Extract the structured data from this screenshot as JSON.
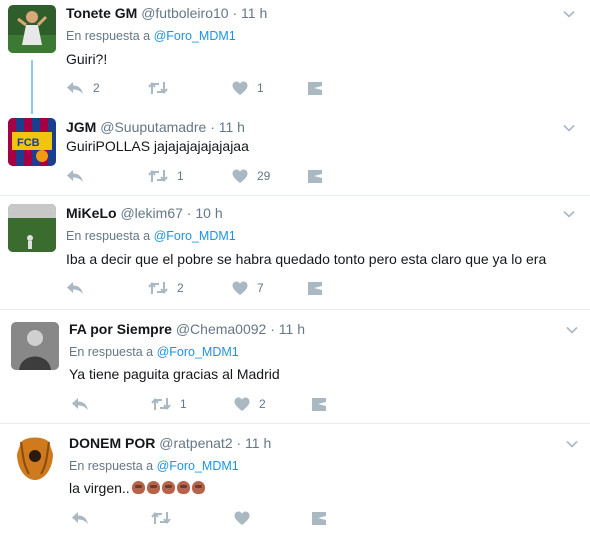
{
  "tweets": [
    {
      "name": "Tonete GM",
      "handle": "@futboleiro10",
      "sep": "·",
      "time": "11 h",
      "reply_prefix": "En respuesta a",
      "reply_to": "@Foro_MDM1",
      "text": "Guiri?!",
      "replies": "2",
      "retweets": "",
      "likes": "1",
      "avatar_color": "#3f7a3a"
    },
    {
      "name": "JGM",
      "handle": "@Suuputamadre",
      "sep": "·",
      "time": "11 h",
      "reply_prefix": "",
      "reply_to": "",
      "text": "GuiriPOLLAS jajajajajajajajaa",
      "replies": "",
      "retweets": "1",
      "likes": "29",
      "avatar_color": "#a50044"
    },
    {
      "name": "MiKeLo",
      "handle": "@lekim67",
      "sep": "·",
      "time": "10 h",
      "reply_prefix": "En respuesta a",
      "reply_to": "@Foro_MDM1",
      "text": "Iba a decir que el pobre se habra quedado tonto pero esta claro que ya lo era",
      "replies": "",
      "retweets": "2",
      "likes": "7",
      "avatar_color": "#2f5d28"
    },
    {
      "name": "FA por Siempre",
      "handle": "@Chema0092",
      "sep": "·",
      "time": "11 h",
      "reply_prefix": "En respuesta a",
      "reply_to": "@Foro_MDM1",
      "text": "Ya tiene paguita gracias al Madrid",
      "replies": "",
      "retweets": "1",
      "likes": "2",
      "avatar_color": "#7a7a7a"
    },
    {
      "name": "DONEM POR",
      "handle": "@ratpenat2",
      "sep": "·",
      "time": "11 h",
      "reply_prefix": "En respuesta a",
      "reply_to": "@Foro_MDM1",
      "text": "la virgen..",
      "emoji_count": 5,
      "replies": "",
      "retweets": "",
      "likes": "",
      "avatar_color": "#c8741f"
    }
  ],
  "icons": {
    "reply": "reply-icon",
    "retweet": "retweet-icon",
    "like": "heart-icon",
    "dm": "direct-message-icon",
    "more": "chevron-down-icon"
  },
  "colors": {
    "link": "#1b95e0",
    "muted": "#657786",
    "icon": "#aab8c2",
    "thread_line": "#8ec9ef",
    "divider": "#e6ecf0"
  }
}
